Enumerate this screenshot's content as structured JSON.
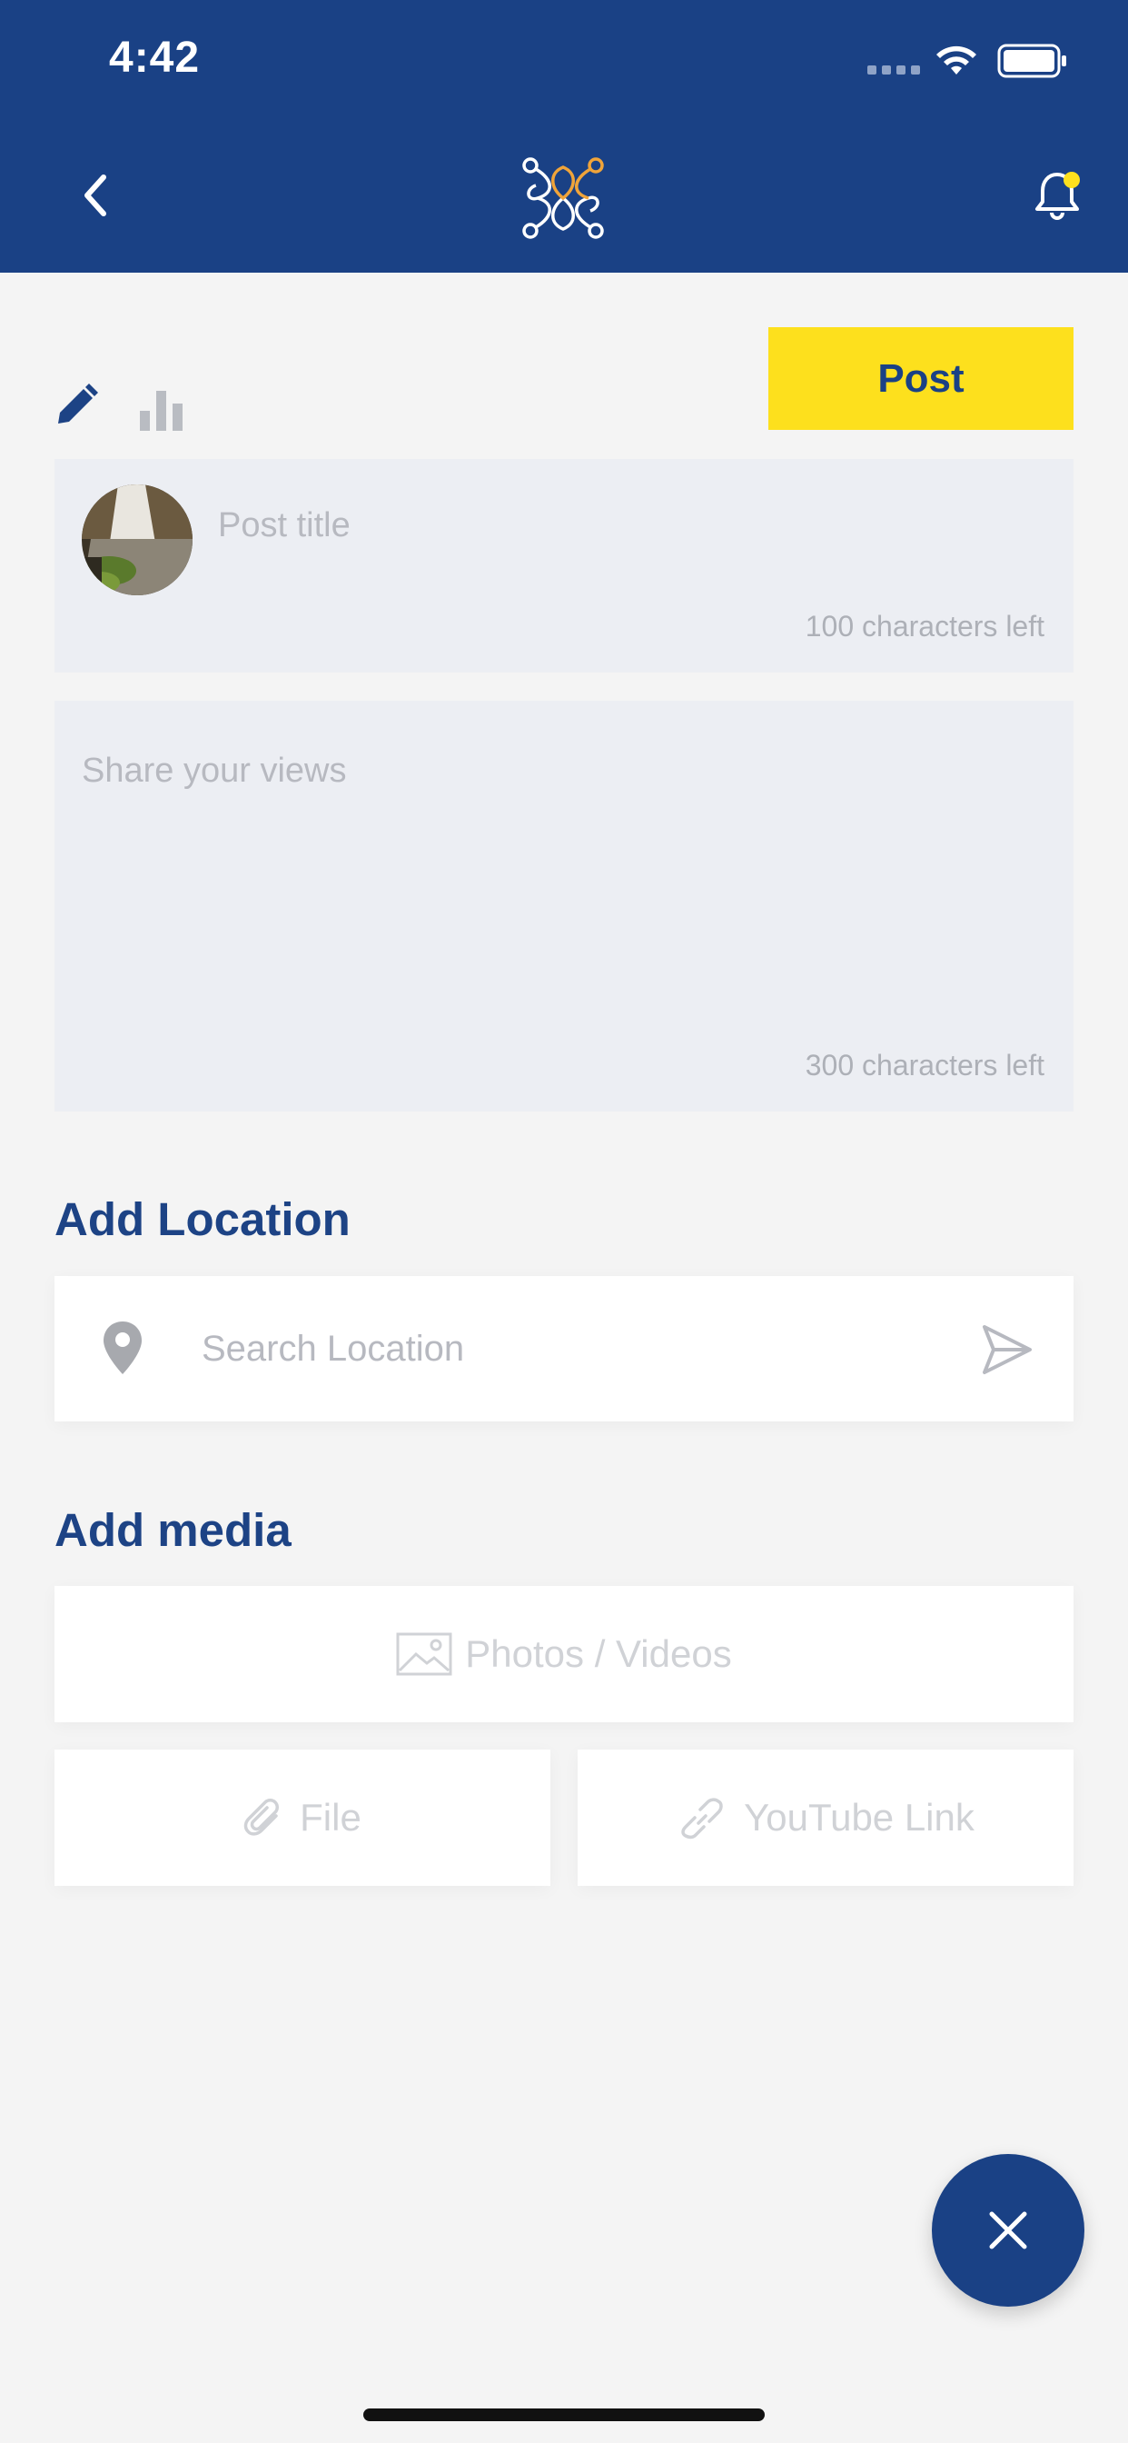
{
  "status_bar": {
    "time": "4:42"
  },
  "header": {
    "back_icon": "chevron-left-icon",
    "logo_icon": "app-logo",
    "notification_icon": "bell-icon",
    "notification_dot_color": "#fde01d"
  },
  "composer": {
    "modes": [
      "pencil-icon",
      "bar-chart-icon"
    ],
    "post_label": "Post",
    "title_placeholder": "Post title",
    "title_count": "100 characters left",
    "views_placeholder": "Share your views",
    "views_count": "300 characters left"
  },
  "location": {
    "heading": "Add Location",
    "search_placeholder": "Search Location"
  },
  "media": {
    "heading": "Add media",
    "photos_label": "Photos / Videos",
    "file_label": "File",
    "youtube_label": "YouTube Link"
  },
  "colors": {
    "brand_blue": "#1a4185",
    "accent_yellow": "#fde01d",
    "logo_orange": "#f0a43a"
  }
}
